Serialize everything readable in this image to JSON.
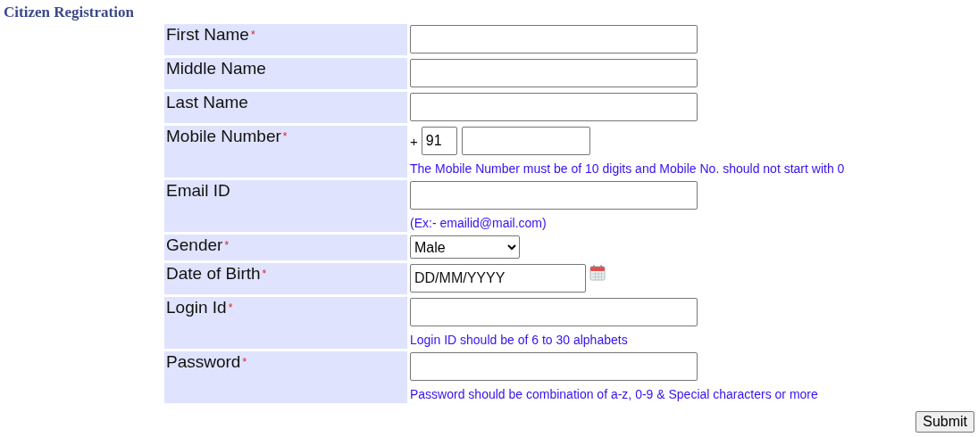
{
  "title": "Citizen Registration",
  "fields": [
    {
      "kind": "text",
      "label": "First Name",
      "asterisk": "*"
    },
    {
      "kind": "text",
      "label": "Middle Name"
    },
    {
      "kind": "text",
      "label": "Last Name"
    },
    {
      "kind": "phone",
      "label": "Mobile Number",
      "asterisk": "*",
      "prefix": "+",
      "code": "91",
      "hint": "The Mobile Number must be of 10 digits and Mobile No. should not start with 0"
    },
    {
      "kind": "text",
      "label": "Email ID",
      "hint": "(Ex:- emailid@mail.com)"
    },
    {
      "kind": "select",
      "label": "Gender",
      "asterisk": "*",
      "value": "Male"
    },
    {
      "kind": "date",
      "label": "Date of Birth",
      "asterisk": "*",
      "value": "DD/MM/YYYY"
    },
    {
      "kind": "text",
      "label": "Login Id",
      "asterisk": "*",
      "hint": "Login ID should be of 6 to 30 alphabets"
    },
    {
      "kind": "text",
      "label": "Password",
      "asterisk": "*",
      "hint": "Password should be combination of a-z, 0-9 & Special characters or more"
    }
  ],
  "submit": "Submit"
}
